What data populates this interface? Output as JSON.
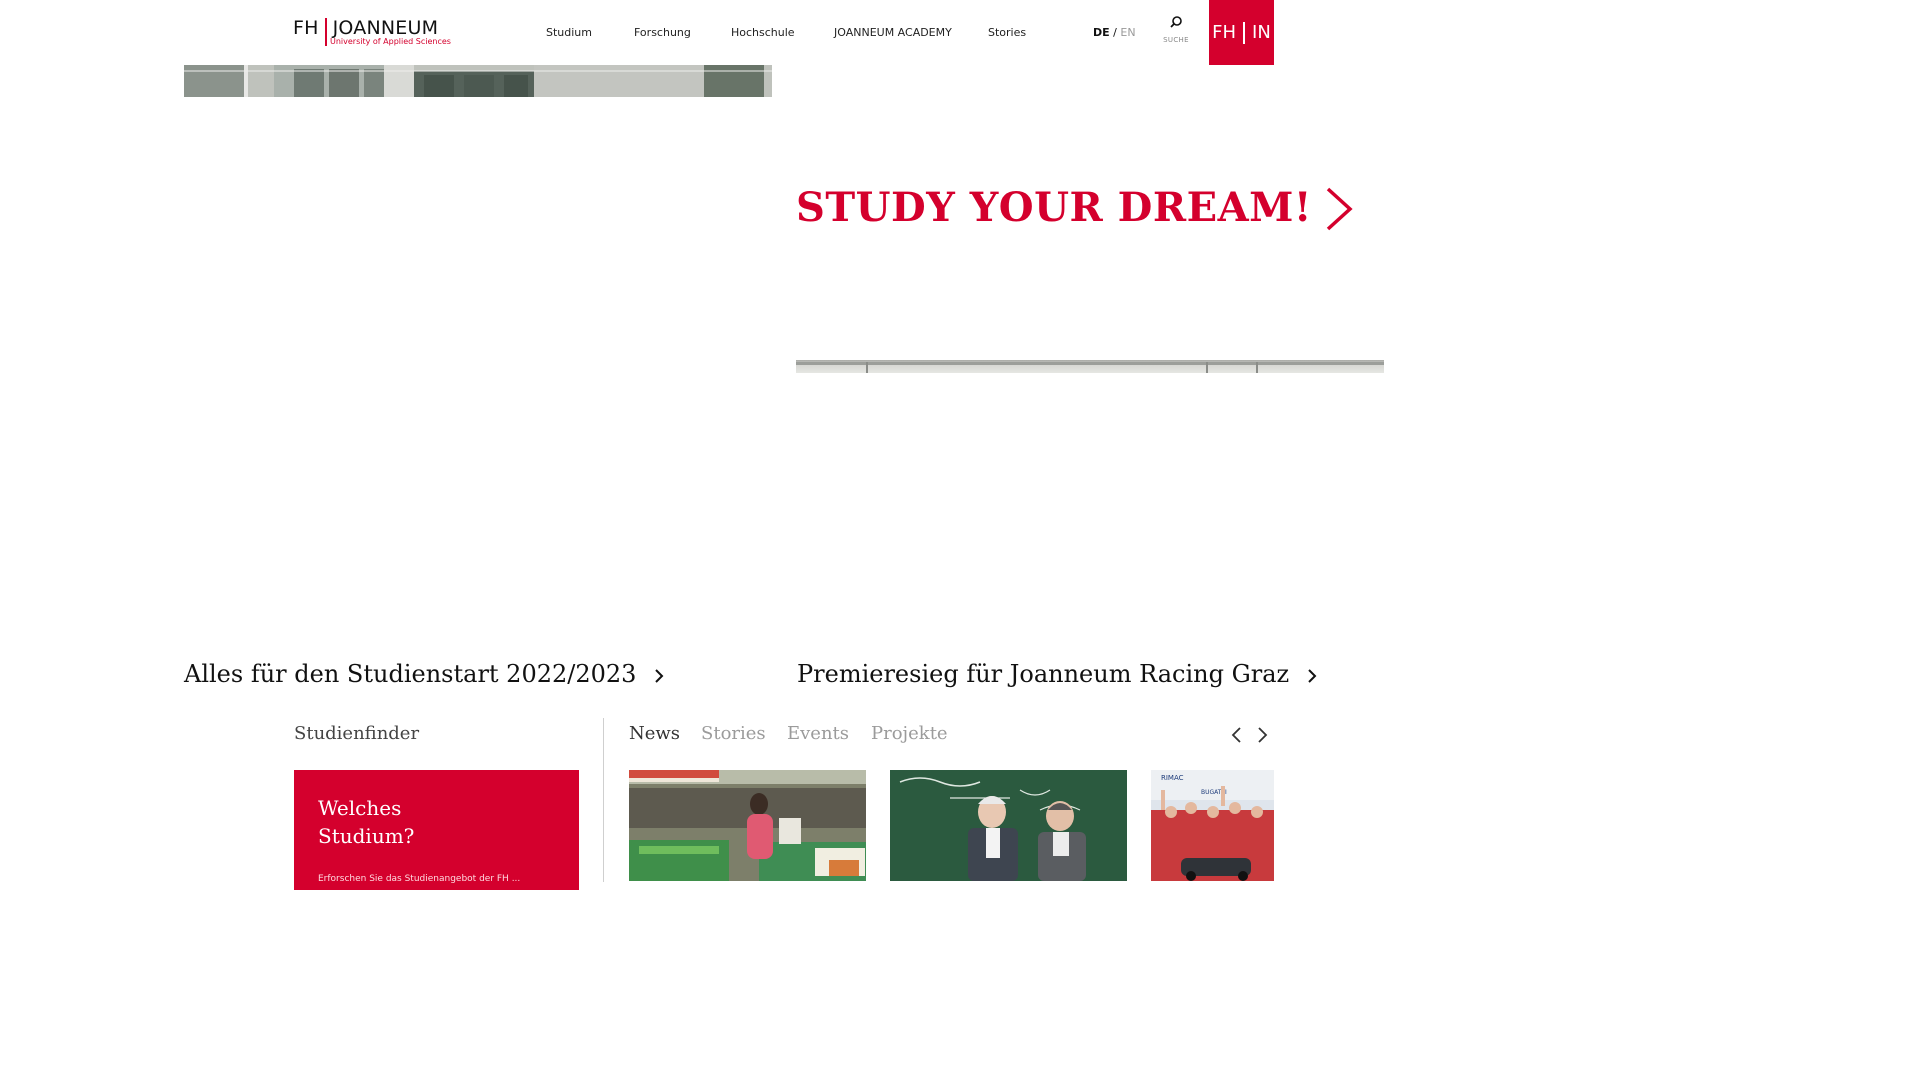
{
  "header": {
    "logo": {
      "main_left": "FH",
      "main_right": "JOANNEUM",
      "sub": "University of Applied Sciences"
    },
    "nav": [
      {
        "label": "Studium"
      },
      {
        "label": "Forschung"
      },
      {
        "label": "Hochschule"
      },
      {
        "label": "JOANNEUM ACADEMY"
      },
      {
        "label": "Stories"
      }
    ],
    "lang": {
      "de": "DE",
      "separator": "/",
      "en": "EN"
    },
    "search_label": "SUCHE",
    "badge": {
      "left": "FH",
      "right": "IN"
    }
  },
  "hero": {
    "title": "STUDY YOUR DREAM!"
  },
  "teasers": [
    {
      "label": "Alles für den Studienstart 2022/2023"
    },
    {
      "label": "Premieresieg für Joanneum Racing Graz"
    }
  ],
  "finder": {
    "title": "Studienfinder",
    "card_heading": "Welches\nStudium?",
    "card_text": "Erforschen Sie das Studienangebot der FH ..."
  },
  "tabs": [
    {
      "label": "News",
      "active": true
    },
    {
      "label": "Stories",
      "active": false
    },
    {
      "label": "Events",
      "active": false
    },
    {
      "label": "Projekte",
      "active": false
    }
  ],
  "colors": {
    "brand_red": "#d4002d",
    "text_dark": "#111111",
    "text_muted": "#9b9b9b"
  }
}
